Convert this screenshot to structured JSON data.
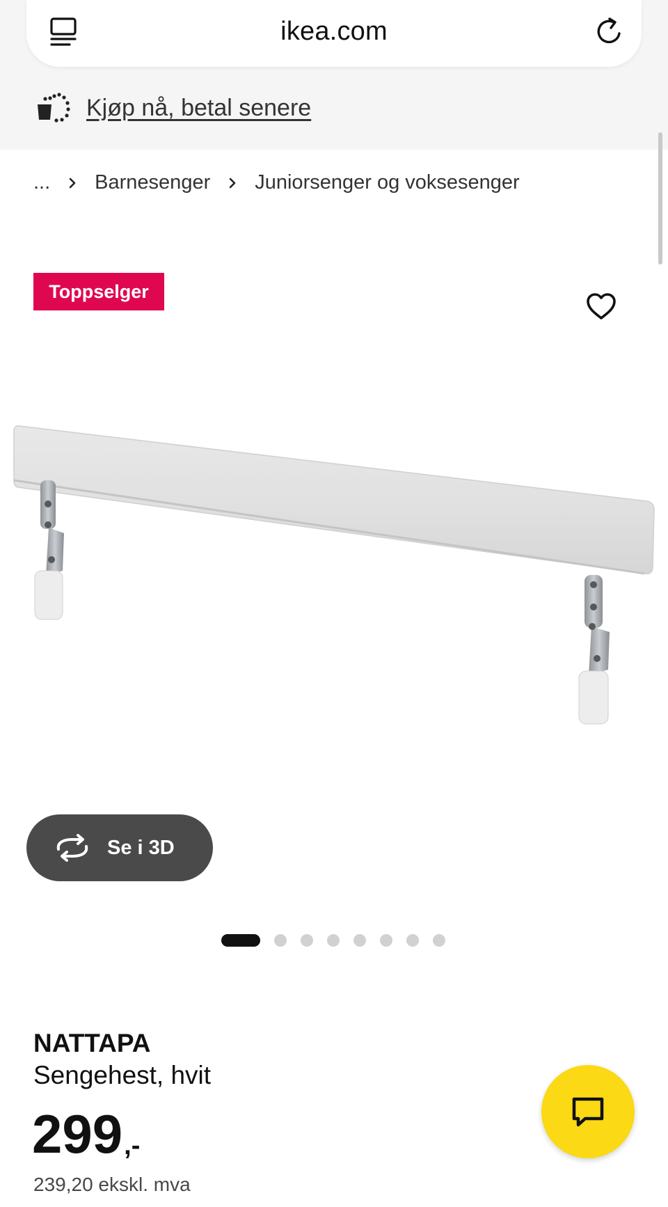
{
  "browser": {
    "url": "ikea.com",
    "left_icon": "tabs-menu-icon",
    "right_icon": "reload-icon"
  },
  "promo": {
    "icon": "shopping-bag-dots-icon",
    "link_label": "Kjøp nå, betal senere"
  },
  "breadcrumb": {
    "items": [
      "...",
      "Barnesenger",
      "Juniorsenger og voksesenger"
    ],
    "separator_icon": "chevron-right-icon"
  },
  "badge": {
    "label": "Toppselger",
    "color": "#e00751"
  },
  "favorite": {
    "icon": "heart-outline-icon"
  },
  "view3d": {
    "label": "Se i 3D",
    "icon": "rotate-3d-icon"
  },
  "carousel": {
    "total_images": 8,
    "active_index": 0
  },
  "product": {
    "name": "NATTAPA",
    "description": "Sengehest, hvit",
    "price_integer": "299",
    "price_suffix": ",-",
    "price_excl_vat": "239,20 ekskl. mva"
  },
  "chat": {
    "icon": "chat-bubble-icon",
    "color": "#fbd914"
  }
}
